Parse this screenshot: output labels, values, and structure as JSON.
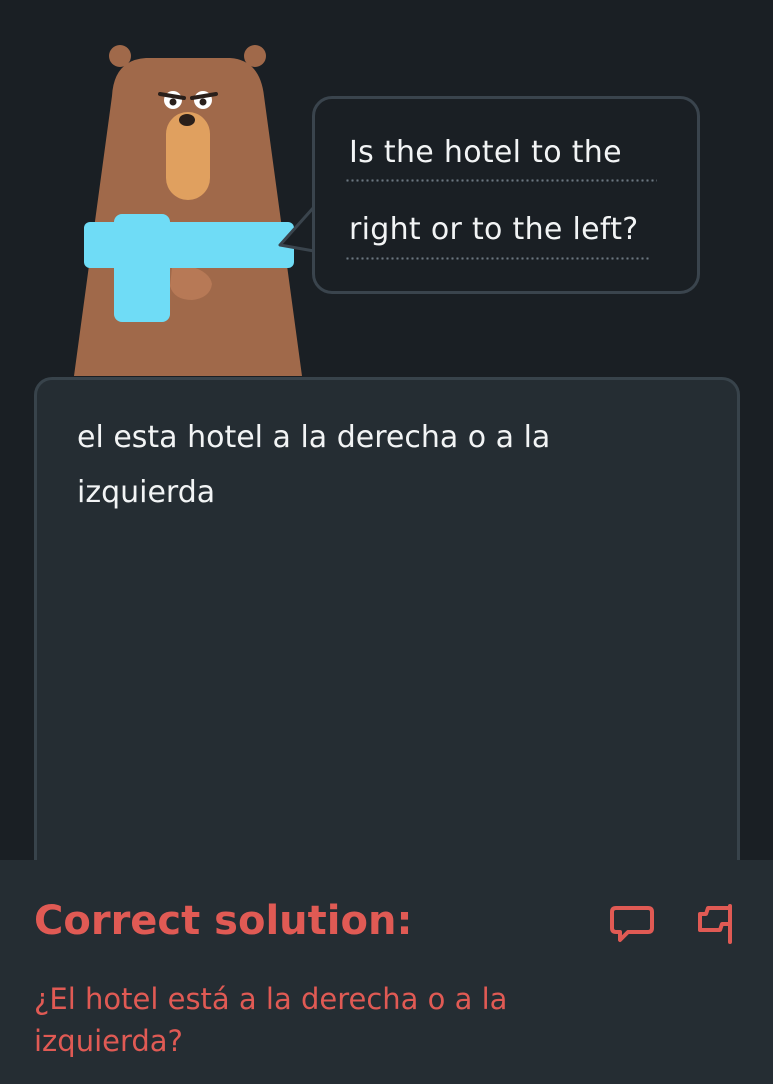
{
  "bubble": {
    "line1": "Is the hotel to the",
    "line2": "right or to the left?"
  },
  "answer": {
    "text": "el esta hotel a la derecha o a la izquierda"
  },
  "footer": {
    "title": "Correct solution:",
    "solution": "¿El hotel está a la derecha o a la izquierda?"
  },
  "colors": {
    "background": "#1a1f24",
    "panel": "#252d33",
    "error_red": "#e05a54",
    "bear_brown": "#a0694a",
    "scarf": "#6fdcf6"
  },
  "icons": {
    "character": "bear-character",
    "comment": "comment-icon",
    "flag": "flag-icon"
  }
}
